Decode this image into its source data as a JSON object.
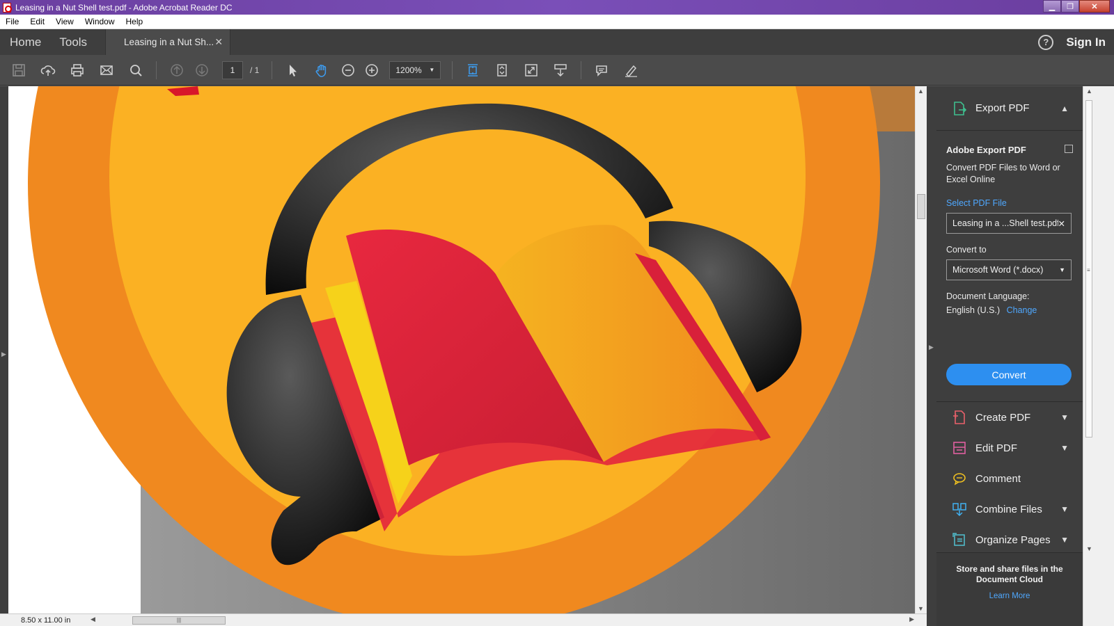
{
  "window": {
    "title": "Leasing in a Nut Shell test.pdf - Adobe Acrobat Reader DC"
  },
  "menu": [
    "File",
    "Edit",
    "View",
    "Window",
    "Help"
  ],
  "tabs": {
    "home": "Home",
    "tools": "Tools",
    "document": "Leasing in a Nut Sh...",
    "sign_in": "Sign In"
  },
  "toolbar": {
    "page_current": "1",
    "page_total": "/ 1",
    "zoom": "1200%"
  },
  "status": {
    "page_size": "8.50 x 11.00 in"
  },
  "panel": {
    "export_header": "Export PDF",
    "title": "Adobe Export PDF",
    "description": "Convert PDF Files to Word or Excel Online",
    "select_label": "Select PDF File",
    "selected_file": "Leasing in a ...Shell test.pdf",
    "convert_to_label": "Convert to",
    "convert_to_value": "Microsoft Word (*.docx)",
    "language_label": "Document Language:",
    "language_value": "English (U.S.)",
    "change_link": "Change",
    "convert_button": "Convert",
    "tools": [
      "Create PDF",
      "Edit PDF",
      "Comment",
      "Combine Files",
      "Organize Pages"
    ],
    "footer_text": "Store and share files in the Document Cloud",
    "footer_link": "Learn More"
  },
  "colors": {
    "accent": "#2d8ff0",
    "link": "#4fa8ff",
    "orange_outer": "#f0891f",
    "orange_inner": "#fbb123",
    "red": "#e3263d",
    "yellow": "#f6d21a"
  }
}
